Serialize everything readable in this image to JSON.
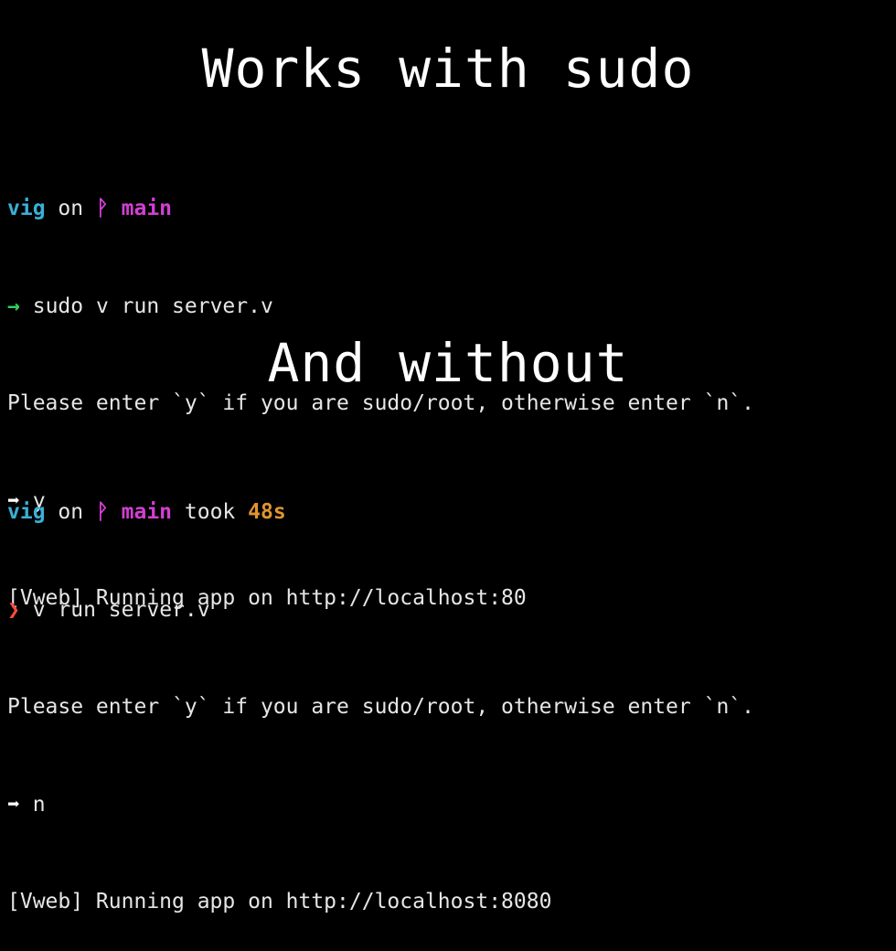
{
  "headings": {
    "with_sudo": "Works with sudo",
    "without": "And without"
  },
  "colors": {
    "background": "#000000",
    "user": "#3ab0d6",
    "branch": "#d13fd1",
    "duration": "#e0952f",
    "prompt_success": "#2fd15a",
    "prompt_error": "#ff4a3a"
  },
  "session1": {
    "prompt": {
      "user": "vig",
      "on": "on",
      "branch_icon": "git-branch-icon",
      "branch": "main"
    },
    "command": {
      "prompt_symbol": "→",
      "text": "sudo v run server.v"
    },
    "question": "Please enter `y` if you are sudo/root, otherwise enter `n`.",
    "answer": {
      "arrow": "➡",
      "text": "y"
    },
    "output": "[Vweb] Running app on http://localhost:80"
  },
  "session2": {
    "prompt": {
      "user": "vig",
      "on": "on",
      "branch_icon": "git-branch-icon",
      "branch": "main",
      "took": "took",
      "duration": "48s"
    },
    "command": {
      "prompt_symbol": "❯",
      "text": "v run server.v"
    },
    "question": "Please enter `y` if you are sudo/root, otherwise enter `n`.",
    "answer": {
      "arrow": "➡",
      "text": "n"
    },
    "output": "[Vweb] Running app on http://localhost:8080"
  }
}
